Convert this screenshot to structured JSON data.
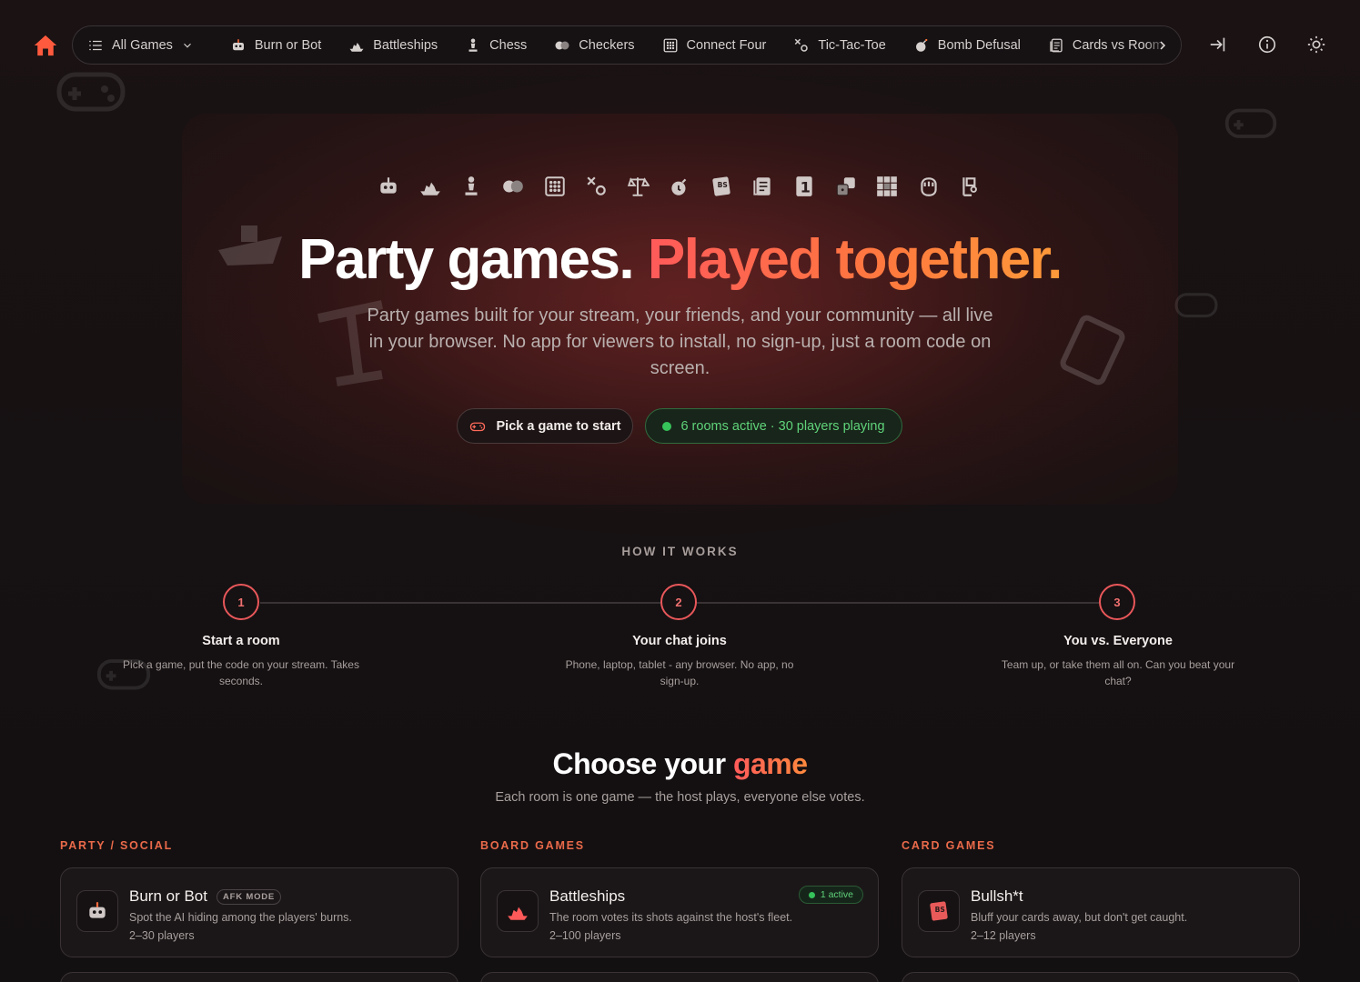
{
  "colors": {
    "accent": "#ff5a5a",
    "accent_orange": "#ff8a3d",
    "green": "#35c35a",
    "background": "#141010"
  },
  "nav": {
    "home_icon": "home-icon",
    "items": [
      {
        "label": "All Games",
        "icon": "list-icon"
      },
      {
        "label": "Burn or Bot",
        "icon": "robot-icon"
      },
      {
        "label": "Battleships",
        "icon": "ship-icon"
      },
      {
        "label": "Chess",
        "icon": "chess-pawn-icon"
      },
      {
        "label": "Checkers",
        "icon": "checkers-icon"
      },
      {
        "label": "Connect Four",
        "icon": "grid-icon"
      },
      {
        "label": "Tic-Tac-Toe",
        "icon": "x-o-icon"
      },
      {
        "label": "Bomb Defusal",
        "icon": "bomb-icon"
      },
      {
        "label": "Cards vs Room",
        "icon": "cards-icon"
      }
    ],
    "right_icons": [
      "login-icon",
      "info-icon",
      "sun-icon"
    ]
  },
  "hero": {
    "title_main": "Party games. ",
    "title_accent": "Played together.",
    "subtitle": "Party games built for your stream, your friends, and your community — all live in your browser. No app for viewers to install, no sign-up, just a room code on screen.",
    "pick_button": "Pick a game to start",
    "rooms_status": "6 rooms active · 30 players playing",
    "game_icons": [
      "robot-icon",
      "ship-icon",
      "chess-pawn-icon",
      "checkers-icon",
      "grid-icon",
      "x-o-icon",
      "scales-icon",
      "bomb-icon",
      "bs-card-icon",
      "cards-icon",
      "number-one-icon",
      "dice-icon",
      "tiles-icon",
      "fist-icon",
      "flag-icon"
    ]
  },
  "how": {
    "label": "HOW IT WORKS",
    "steps": [
      {
        "num": "1",
        "title": "Start a room",
        "desc": "Pick a game, put the code on your stream. Takes seconds."
      },
      {
        "num": "2",
        "title": "Your chat joins",
        "desc": "Phone, laptop, tablet - any browser. No app, no sign-up."
      },
      {
        "num": "3",
        "title": "You vs. Everyone",
        "desc": "Team up, or take them all on. Can you beat your chat?"
      }
    ]
  },
  "choose": {
    "title_main": "Choose your ",
    "title_accent": "game",
    "subtitle": "Each room is one game — the host plays, everyone else votes."
  },
  "categories": [
    {
      "label": "PARTY / SOCIAL",
      "card": {
        "title": "Burn or Bot",
        "badge": "AFK MODE",
        "desc": "Spot the AI hiding among the players' burns.",
        "players": "2–30 players",
        "icon": "robot-icon"
      }
    },
    {
      "label": "BOARD GAMES",
      "card": {
        "title": "Battleships",
        "active": "1 active",
        "desc": "The room votes its shots against the host's fleet.",
        "players": "2–100 players",
        "icon": "ship-icon"
      }
    },
    {
      "label": "CARD GAMES",
      "card": {
        "title": "Bullsh*t",
        "desc": "Bluff your cards away, but don't get caught.",
        "players": "2–12 players",
        "icon": "bs-card-icon"
      }
    }
  ]
}
